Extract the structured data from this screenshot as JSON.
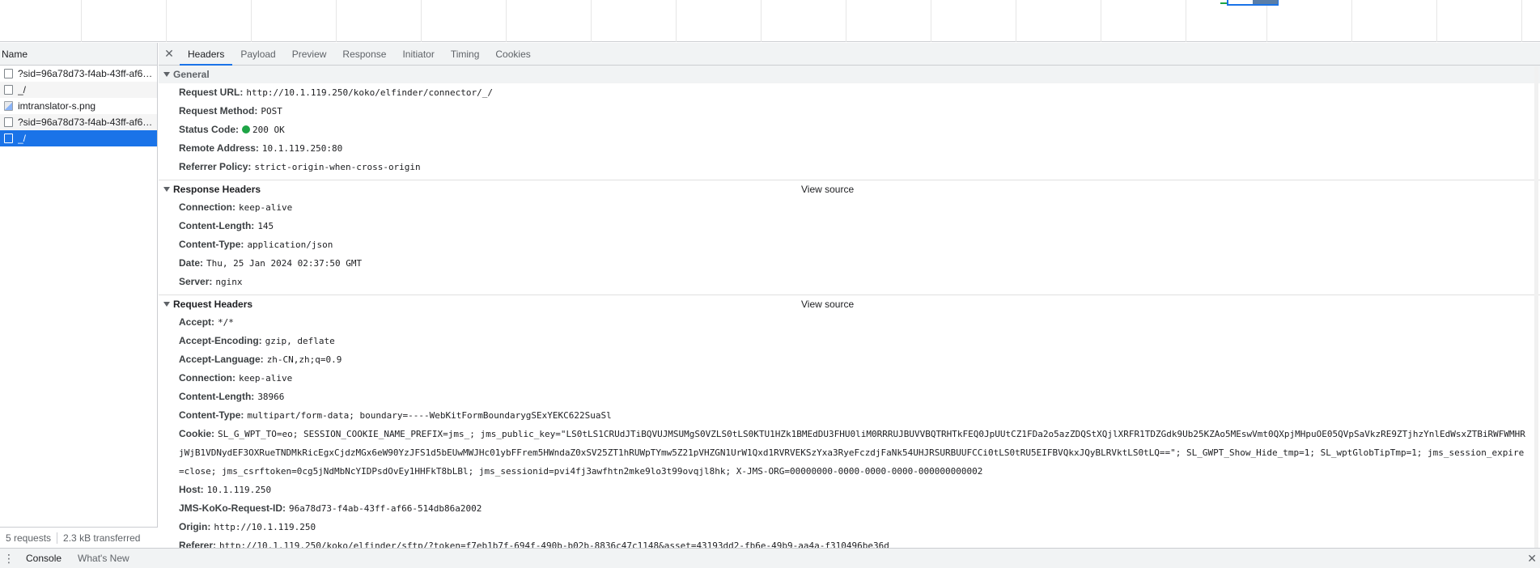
{
  "requests": {
    "column_name": "Name",
    "items": [
      {
        "name": "?sid=96a78d73-f4ab-43ff-af66-514db86a2002",
        "type": "doc",
        "selected": false
      },
      {
        "name": "_/",
        "type": "doc",
        "selected": false
      },
      {
        "name": "imtranslator-s.png",
        "type": "img",
        "selected": false
      },
      {
        "name": "?sid=96a78d73-f4ab-43ff-af66-514db86a2002",
        "type": "doc",
        "selected": false
      },
      {
        "name": "_/",
        "type": "doc",
        "selected": true
      }
    ],
    "status_requests": "5 requests",
    "status_transferred": "2.3 kB transferred"
  },
  "tabs": [
    "Headers",
    "Payload",
    "Preview",
    "Response",
    "Initiator",
    "Timing",
    "Cookies"
  ],
  "active_tab": "Headers",
  "general": {
    "title": "General",
    "rows": [
      {
        "k": "Request URL:",
        "v": "http://10.1.119.250/koko/elfinder/connector/_/"
      },
      {
        "k": "Request Method:",
        "v": "POST"
      },
      {
        "k": "Status Code:",
        "v": "200 OK"
      },
      {
        "k": "Remote Address:",
        "v": "10.1.119.250:80"
      },
      {
        "k": "Referrer Policy:",
        "v": "strict-origin-when-cross-origin"
      }
    ]
  },
  "response_headers": {
    "title": "Response Headers",
    "view_source": "View source",
    "rows": [
      {
        "k": "Connection:",
        "v": "keep-alive"
      },
      {
        "k": "Content-Length:",
        "v": "145"
      },
      {
        "k": "Content-Type:",
        "v": "application/json"
      },
      {
        "k": "Date:",
        "v": "Thu, 25 Jan 2024 02:37:50 GMT"
      },
      {
        "k": "Server:",
        "v": "nginx"
      }
    ]
  },
  "request_headers": {
    "title": "Request Headers",
    "view_source": "View source",
    "rows": [
      {
        "k": "Accept:",
        "v": "*/*"
      },
      {
        "k": "Accept-Encoding:",
        "v": "gzip, deflate"
      },
      {
        "k": "Accept-Language:",
        "v": "zh-CN,zh;q=0.9"
      },
      {
        "k": "Connection:",
        "v": "keep-alive"
      },
      {
        "k": "Content-Length:",
        "v": "38966"
      },
      {
        "k": "Content-Type:",
        "v": "multipart/form-data; boundary=----WebKitFormBoundarygSExYEKC622SuaSl"
      },
      {
        "k": "Cookie:",
        "v": "SL_G_WPT_TO=eo; SESSION_COOKIE_NAME_PREFIX=jms_; jms_public_key=\"LS0tLS1CRUdJTiBQVUJMSUMgS0VZLS0tLS0KTU1HZk1BMEdDU3FHU0liM0RRRUJBUVVBQTRHTkFEQ0JpUUtCZ1FDa2o5azZDQStXQjlXRFR1TDZGdk9Ub25KZAo5MEswVmt0QXpjMHpuOE05QVpSaVkzRE9ZTjhzYnlEdWsxZTBiRWFWMHRjWjB1VDNydEF3OXRueTNDMkRicEgxCjdzMGx6eW90YzJFS1d5bEUwMWJHc01ybFFrem5HWndaZ0xSV25ZT1hRUWpTYmw5Z21pVHZGN1UrW1Qxd1RVRVEKSzYxa3RyeFczdjFaNk54UHJRSURBUUFCCi0tLS0tRU5EIFBVQkxJQyBLRVktLS0tLQ==\"; SL_GWPT_Show_Hide_tmp=1; SL_wptGlobTipTmp=1; jms_session_expire=close; jms_csrftoken=0cg5jNdMbNcYIDPsdOvEy1HHFkT8bLBl; jms_sessionid=pvi4fj3awfhtn2mke9lo3t99ovqjl8hk; X-JMS-ORG=00000000-0000-0000-0000-000000000002"
      },
      {
        "k": "Host:",
        "v": "10.1.119.250"
      },
      {
        "k": "JMS-KoKo-Request-ID:",
        "v": "96a78d73-f4ab-43ff-af66-514db86a2002"
      },
      {
        "k": "Origin:",
        "v": "http://10.1.119.250"
      },
      {
        "k": "Referer:",
        "v": "http://10.1.119.250/koko/elfinder/sftp/?token=f7eb1b7f-694f-490b-b02b-8836c47c1148&asset=43193dd2-fb6e-49b9-aa4a-f310496be36d"
      }
    ]
  },
  "drawer": {
    "tabs": [
      "Console",
      "What's New"
    ]
  },
  "colors": {
    "accent": "#1a73e8",
    "status_ok": "#1ea446"
  }
}
